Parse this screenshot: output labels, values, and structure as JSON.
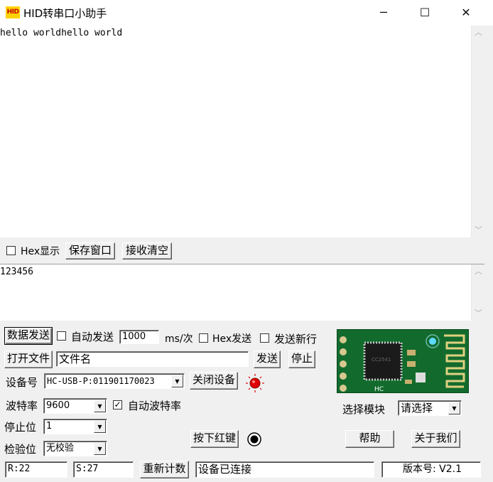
{
  "window": {
    "icon_text": "HID",
    "title": "HID转串口小助手",
    "minimize": "─",
    "maximize": "☐",
    "close": "✕"
  },
  "receive": {
    "text": "hello worldhello world"
  },
  "receive_toolbar": {
    "hex_display_label": "Hex显示",
    "save_window": "保存窗口",
    "clear_receive": "接收清空"
  },
  "send": {
    "text": "123456"
  },
  "send_controls": {
    "send_data": "数据发送",
    "auto_send_label": "自动发送",
    "interval_value": "1000",
    "interval_unit": "ms/次",
    "hex_send_label": "Hex发送",
    "send_newline_label": "发送新行",
    "open_file": "打开文件",
    "file_name": "文件名",
    "send_file": "发送",
    "stop": "停止"
  },
  "device": {
    "device_label": "设备号",
    "device_value": "HC-USB-P:011901170023",
    "close_device": "关闭设备",
    "baud_label": "波特率",
    "baud_value": "9600",
    "auto_baud_label": "自动波特率",
    "stopbit_label": "停止位",
    "stopbit_value": "1",
    "parity_label": "检验位",
    "parity_value": "无校验",
    "red_key": "按下红键"
  },
  "module": {
    "select_label": "选择模块",
    "select_value": "请选择",
    "help": "帮助",
    "about": "关于我们"
  },
  "status": {
    "rx": "R:22",
    "tx": "S:27",
    "reset_count": "重新计数",
    "connection": "设备已连接",
    "version": "版本号: V2.1"
  },
  "colors": {
    "led_red": "#e00000",
    "pcb_green": "#126b2d"
  }
}
